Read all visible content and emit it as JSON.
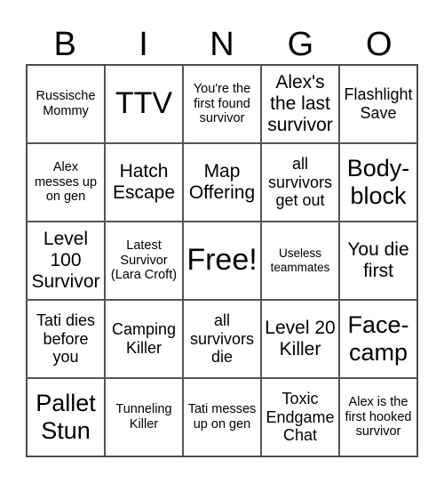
{
  "header": [
    "B",
    "I",
    "N",
    "G",
    "O"
  ],
  "cells": [
    "Russische Mommy",
    "TTV",
    "You're the first found survivor",
    "Alex's the last survivor",
    "Flashlight Save",
    "Alex messes up on gen",
    "Hatch Escape",
    "Map Offering",
    "all survivors get out",
    "Body-block",
    "Level 100 Survivor",
    "Latest Survivor (Lara Croft)",
    "Free!",
    "Useless teammates",
    "You die first",
    "Tati dies before you",
    "Camping Killer",
    "all survivors die",
    "Level 20 Killer",
    "Face-camp",
    "Pallet Stun",
    "Tunneling Killer",
    "Tati messes up on gen",
    "Toxic Endgame Chat",
    "Alex is the first hooked survivor"
  ]
}
